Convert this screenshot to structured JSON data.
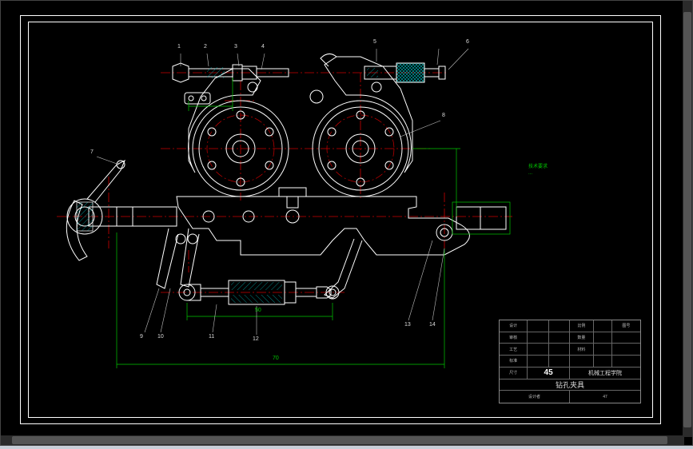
{
  "domain": "Diagram",
  "app": "CAD Viewer",
  "colors": {
    "outline": "#ffffff",
    "centerline": "#cc0000",
    "dimension": "#00c800",
    "hatch": "#00a0a0",
    "text_muted": "#bbbbbb",
    "background": "#000000"
  },
  "drawing": {
    "frame": {
      "outer": [
        24,
        18,
        802,
        512
      ],
      "inner": [
        34,
        26,
        782,
        496
      ]
    },
    "leaders": {
      "top": [
        "1",
        "2",
        "3",
        "4",
        "5",
        "6"
      ],
      "left_top": "7",
      "right_mid": "8",
      "bottom_left": [
        "9",
        "10"
      ],
      "bottom_mid": [
        "11",
        "12"
      ],
      "bottom_right": [
        "13",
        "14"
      ]
    },
    "dimensions": {
      "d1": "50",
      "d2": "70"
    },
    "annotation_right": "技术要求",
    "annotation_right_line": "..."
  },
  "title_block": {
    "row1": {
      "c1": "设计",
      "c2": "",
      "c3": "",
      "c4": "比例",
      "c5": "",
      "c6": "图号"
    },
    "row2": {
      "c1": "审核",
      "c2": "",
      "c3": "",
      "c4": "数量",
      "c5": "",
      "c6": ""
    },
    "row3": {
      "c1": "工艺",
      "c2": "",
      "c3": "",
      "c4": "材料",
      "c5": "",
      "c6": ""
    },
    "row4": {
      "c1": "标准",
      "c2": "",
      "c3": "",
      "c4": "",
      "c5": "",
      "c6": ""
    },
    "row5_left": "尺寸",
    "row5_scale": "45",
    "row5_right": "机械工程学院",
    "row6_title": "钻孔夹具",
    "row7_l": "设计者",
    "row7_r": "47"
  }
}
